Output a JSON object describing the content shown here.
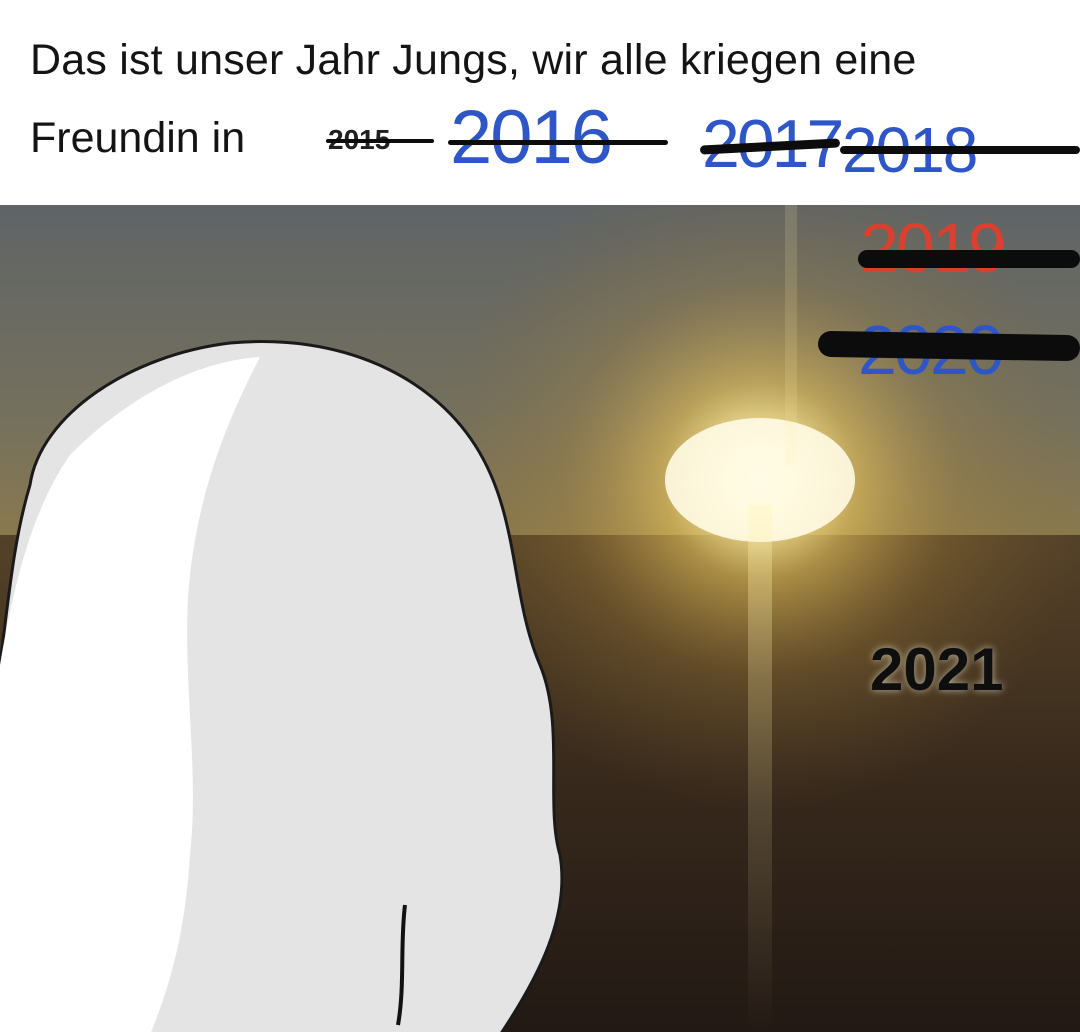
{
  "caption": {
    "line1": "Das ist unser Jahr Jungs, wir alle kriegen eine",
    "line2": "Freundin in"
  },
  "years": {
    "y2015": "2015",
    "y2016": "2016",
    "y2017": "2017",
    "y2018": "2018",
    "y2019": "2019",
    "y2020": "2020",
    "y2021": "2021"
  },
  "colors": {
    "crossed_blue": "#2e56c7",
    "crossed_red": "#d9402f",
    "strike": "#0c0c0c",
    "sun": "#fff6c0",
    "figure": "#e4e4e4"
  },
  "scene": {
    "figure_icon": "wojak-head-silhouette-icon",
    "background": "sunrise-over-field"
  }
}
